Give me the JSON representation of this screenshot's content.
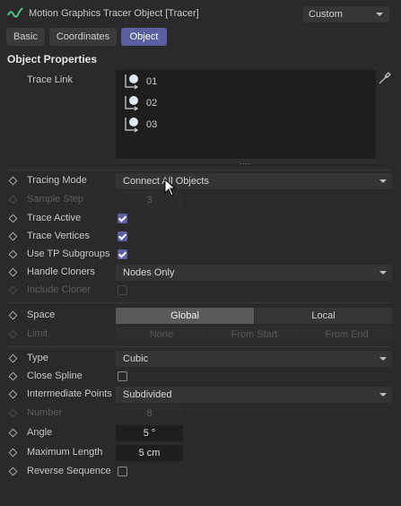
{
  "header": {
    "title": "Motion Graphics Tracer Object [Tracer]",
    "preset": "Custom",
    "logo_icon": "tracer-logo-icon"
  },
  "tabs": [
    {
      "label": "Basic",
      "active": false
    },
    {
      "label": "Coordinates",
      "active": false
    },
    {
      "label": "Object",
      "active": true
    }
  ],
  "section": {
    "title": "Object Properties"
  },
  "trace_link": {
    "label": "Trace Link",
    "items": [
      "01",
      "02",
      "03"
    ],
    "grip": "....",
    "picker_icon": "eyedropper-icon"
  },
  "params": {
    "tracing_mode": {
      "label": "Tracing Mode",
      "value": "Connect All Objects"
    },
    "sample_step": {
      "label": "Sample Step",
      "value": "3",
      "enabled": false
    },
    "trace_active": {
      "label": "Trace Active",
      "checked": true
    },
    "trace_vertices": {
      "label": "Trace Vertices",
      "checked": true
    },
    "use_tp_subgroups": {
      "label": "Use TP Subgroups",
      "checked": true
    },
    "handle_cloners": {
      "label": "Handle Cloners",
      "value": "Nodes Only"
    },
    "include_cloner": {
      "label": "Include Cloner",
      "checked": false,
      "enabled": false
    },
    "space": {
      "label": "Space",
      "options": [
        "Global",
        "Local"
      ],
      "selected": "Global"
    },
    "limit": {
      "label": "Limit",
      "options": [
        "None",
        "From Start",
        "From End"
      ],
      "enabled": false
    },
    "type": {
      "label": "Type",
      "value": "Cubic"
    },
    "close_spline": {
      "label": "Close Spline",
      "checked": false
    },
    "intermediate_points": {
      "label": "Intermediate Points",
      "value": "Subdivided"
    },
    "number": {
      "label": "Number",
      "value": "8",
      "enabled": false
    },
    "angle": {
      "label": "Angle",
      "value": "5 °"
    },
    "maximum_length": {
      "label": "Maximum Length",
      "value": "5 cm"
    },
    "reverse_sequence": {
      "label": "Reverse Sequence",
      "checked": false
    }
  },
  "colors": {
    "background": "#2a2a2a",
    "accent": "#5b5fa0",
    "field": "#1e1e1e"
  }
}
